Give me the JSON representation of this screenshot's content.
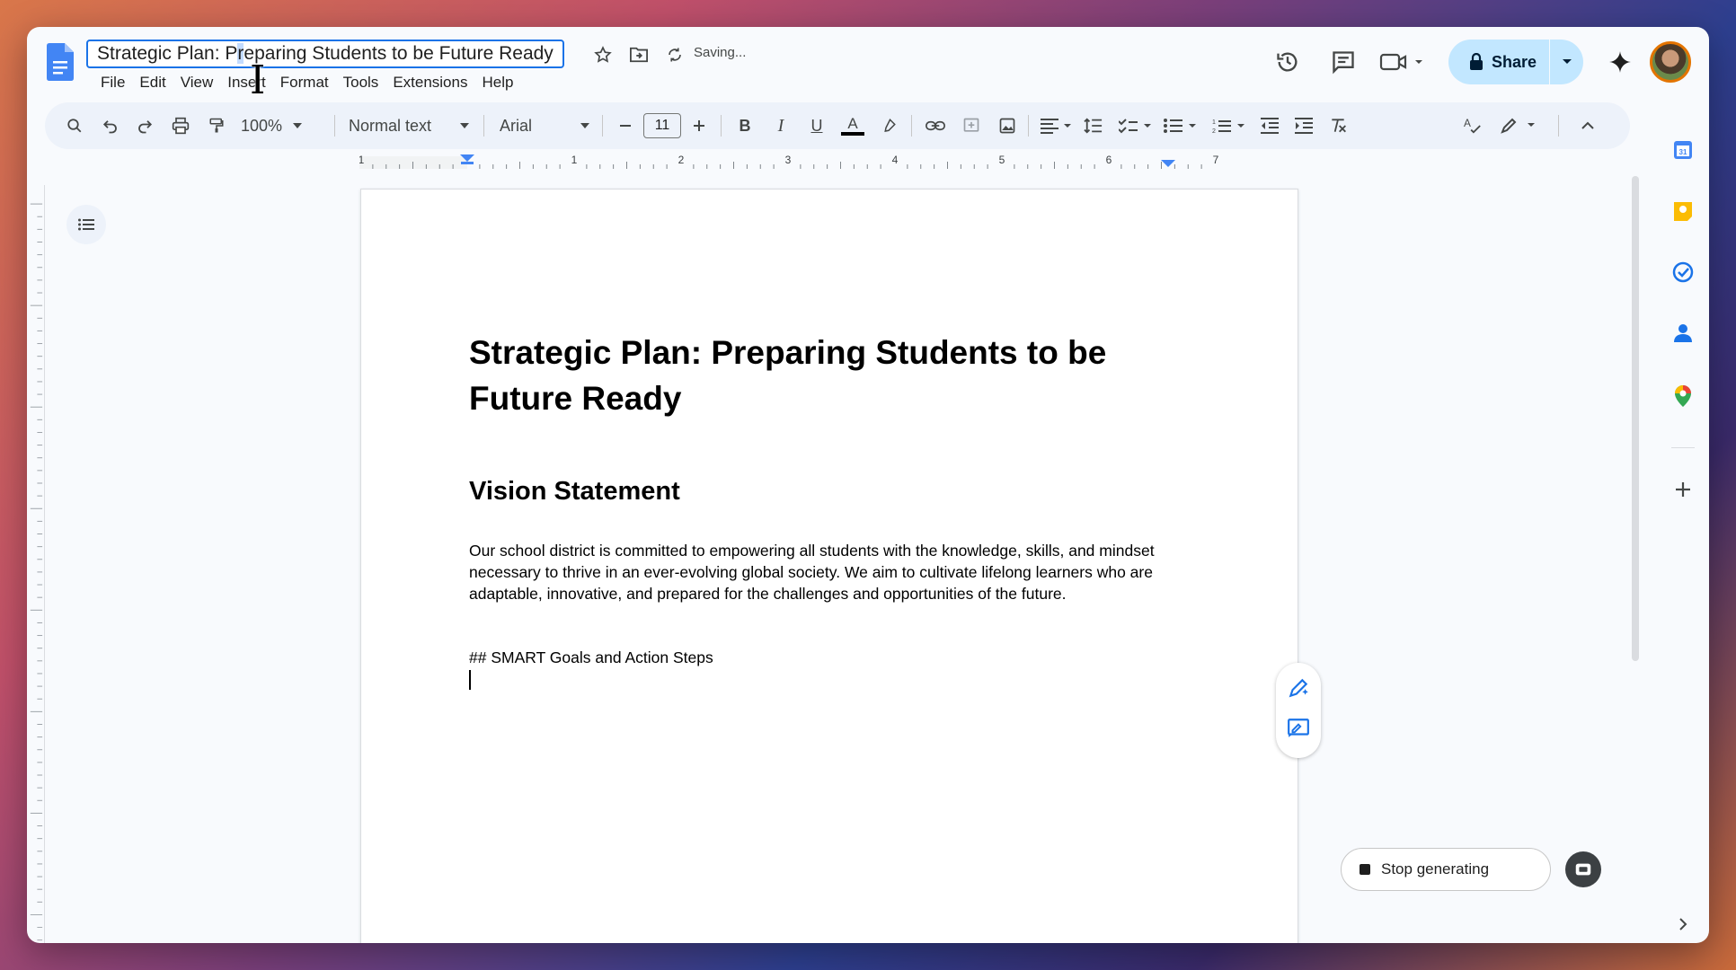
{
  "header": {
    "title_before": "Strategic Plan: P",
    "title_selected": "r",
    "title_after": "eparing Students to be Future Ready",
    "saving": "Saving...",
    "menus": [
      "File",
      "Edit",
      "View",
      "Insert",
      "Format",
      "Tools",
      "Extensions",
      "Help"
    ],
    "share_label": "Share"
  },
  "toolbar": {
    "zoom": "100%",
    "style": "Normal text",
    "font": "Arial",
    "font_size": "11"
  },
  "ruler": {
    "labels": [
      "1",
      "1",
      "2",
      "3",
      "4",
      "5",
      "6",
      "7"
    ]
  },
  "document": {
    "title": "Strategic Plan: Preparing Students to be Future Ready",
    "heading": "Vision Statement",
    "paragraph": "Our school district is committed to empowering all students with the knowledge, skills, and mindset necessary to thrive in an ever-evolving global society. We aim to cultivate lifelong learners who are adaptable, innovative, and prepared for the challenges and opportunities of the future.",
    "markdown_line": "## SMART Goals and Action Steps"
  },
  "generation": {
    "stop_label": "Stop generating"
  },
  "colors": {
    "accent": "#1a73e8",
    "share_bg": "#c2e7ff",
    "toolbar_bg": "#edf2fa"
  }
}
